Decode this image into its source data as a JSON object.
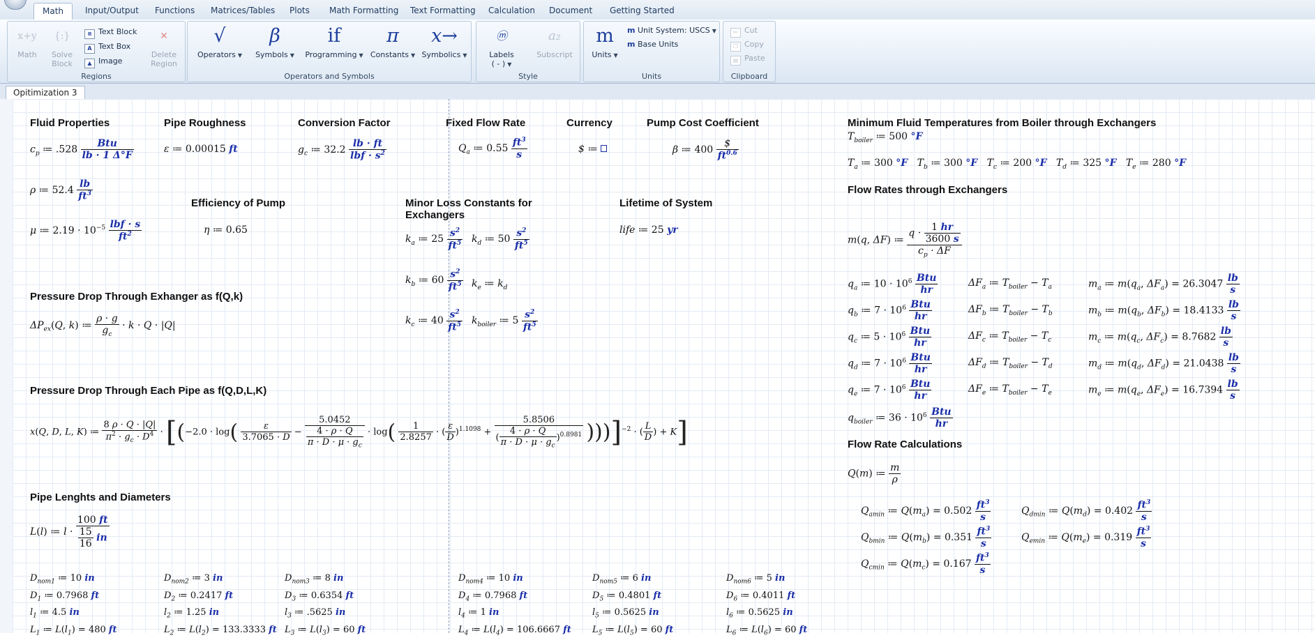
{
  "ribbon": {
    "tabs": [
      "Math",
      "Input/Output",
      "Functions",
      "Matrices/Tables",
      "Plots",
      "Math Formatting",
      "Text Formatting",
      "Calculation",
      "Document",
      "Getting Started"
    ],
    "regions": {
      "math": "Math",
      "solve_block": "Solve Block",
      "text_block": "Text Block",
      "text_box": "Text Box",
      "image": "Image",
      "delete_region": "Delete Region",
      "label": "Regions"
    },
    "ops": {
      "operators": "Operators",
      "symbols": "Symbols",
      "programming": "Programming",
      "constants": "Constants",
      "symbolics": "Symbolics",
      "label": "Operators and Symbols",
      "ops_icon": "√",
      "sym_icon": "β",
      "prog_icon": "if",
      "const_icon": "π",
      "symb_icon": "x→"
    },
    "style": {
      "labels": "Labels",
      "labels_value": "( - )",
      "subscript": "Subscript",
      "label": "Style"
    },
    "units": {
      "units": "Units",
      "unit_system_label": "Unit System:",
      "unit_system_value": "USCS",
      "base_units": "Base Units",
      "label": "Units"
    },
    "clipboard": {
      "cut": "Cut",
      "copy": "Copy",
      "paste": "Paste",
      "label": "Clipboard"
    }
  },
  "document_tab": "Opitimization 3",
  "headings": {
    "fluid": "Fluid Properties",
    "roughness": "Pipe Roughness",
    "conversion": "Conversion Factor",
    "flow": "Fixed Flow Rate",
    "currency": "Currency",
    "pumpcost": "Pump Cost Coefficient",
    "mintemp": "Minimum Fluid Temperatures from Boiler through Exchangers",
    "efficiency": "Efficiency of Pump",
    "minorloss": "Minor Loss Constants for Exchangers",
    "lifetime": "Lifetime of System",
    "flowrates": "Flow Rates through Exchangers",
    "pressure_ex": "Pressure Drop Through Exhanger as f(Q,k)",
    "pressure_pipe": "Pressure Drop Through Each Pipe as f(Q,D,L,K)",
    "flowcalc": "Flow Rate Calculations",
    "pipes": "Pipe Lenghts and Diameters"
  },
  "values": {
    "cp": ".528",
    "rho": "52.4",
    "mu": "2.19",
    "mu_exp": "−5",
    "eps": "0.00015",
    "gc": "32.2",
    "Qa": "0.55",
    "beta": "400",
    "beta_exp": "0.6",
    "eta": "0.65",
    "ka": "25",
    "kd": "50",
    "kb": "60",
    "kc": "40",
    "kboiler": "5",
    "life": "25",
    "Tboiler": "500",
    "Ta": "300",
    "Tb": "300",
    "Tc": "200",
    "Td": "325",
    "Te": "280",
    "qa": "10",
    "qb": "7",
    "qc": "5",
    "qd": "7",
    "qe": "7",
    "qboiler": "36",
    "ma": "26.3047",
    "mb": "18.4133",
    "mc": "8.7682",
    "md": "21.0438",
    "me": "16.7394",
    "Qamin": "0.502",
    "Qbmin": "0.351",
    "Qcmin": "0.167",
    "Qdmin": "0.402",
    "Qemin": "0.319",
    "eq_c1": "−2.0",
    "eq_c2": "3.7065",
    "eq_c3": "5.0452",
    "eq_c4": "1",
    "eq_c5": "2.8257",
    "eq_c6": "1.1098",
    "eq_c7": "5.8506",
    "eq_c8": "0.8981",
    "eq_c9": "−2",
    "eq_c10": "8",
    "Ll_num": "100",
    "Ll_den_a": "15",
    "Ll_den_b": "16",
    "hr_num": "1",
    "hr_den": "3600"
  },
  "pipes": [
    {
      "dnom": "10",
      "D": "0.7968",
      "l": "4.5",
      "L": "480"
    },
    {
      "dnom": "3",
      "D": "0.2417",
      "l": "1.25",
      "L": "133.3333"
    },
    {
      "dnom": "8",
      "D": "0.6354",
      "l": ".5625",
      "L": "60"
    },
    {
      "dnom": "10",
      "D": "0.7968",
      "l": "1",
      "L": "106.6667"
    },
    {
      "dnom": "6",
      "D": "0.4801",
      "l": "0.5625",
      "L": "60"
    },
    {
      "dnom": "5",
      "D": "0.4011",
      "l": "0.5625",
      "L": "60"
    }
  ]
}
